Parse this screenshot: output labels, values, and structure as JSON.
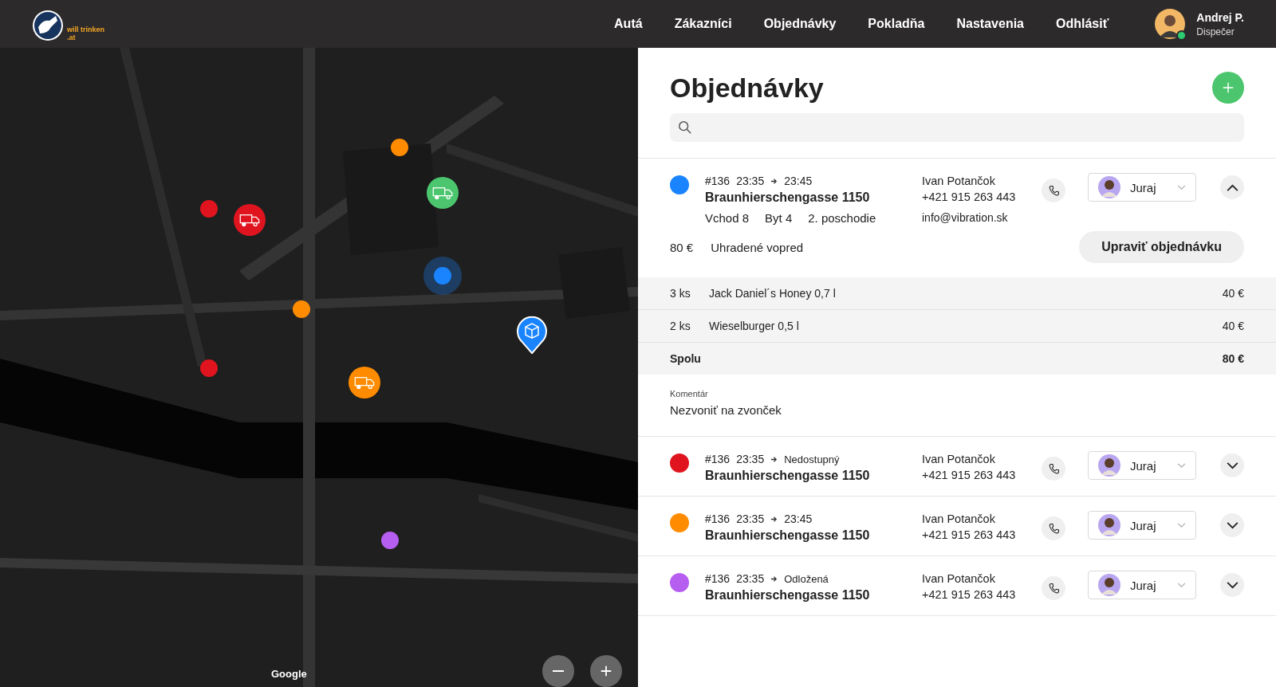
{
  "header": {
    "logo_text": "will trinken .at",
    "nav": [
      {
        "label": "Autá"
      },
      {
        "label": "Zákazníci"
      },
      {
        "label": "Objednávky"
      },
      {
        "label": "Pokladňa"
      },
      {
        "label": "Nastavenia"
      },
      {
        "label": "Odhlásiť"
      }
    ],
    "user": {
      "name": "Andrej P.",
      "role": "Dispečer",
      "online": true
    }
  },
  "map": {
    "attribution": "Google",
    "markers": [
      {
        "kind": "dot",
        "color": "#e0141e"
      },
      {
        "kind": "truck",
        "color": "#e0141e"
      },
      {
        "kind": "dot",
        "color": "#ff8c00"
      },
      {
        "kind": "truck",
        "color": "#4cc66e"
      },
      {
        "kind": "location",
        "color": "#1a84ff"
      },
      {
        "kind": "dot",
        "color": "#ff8c00"
      },
      {
        "kind": "dot",
        "color": "#e0141e"
      },
      {
        "kind": "truck",
        "color": "#ff8c00"
      },
      {
        "kind": "pin",
        "color": "#1a84ff"
      },
      {
        "kind": "dot",
        "color": "#b65ef0"
      }
    ]
  },
  "orders_panel": {
    "title": "Objednávky",
    "orders": [
      {
        "color": "#1a84ff",
        "expanded": true,
        "number": "#136",
        "time_from": "23:35",
        "time_to": "23:45",
        "address": "Braunhierschengasse 1150",
        "customer": "Ivan Potančok",
        "phone": "+421 915 263 443",
        "courier": "Juraj",
        "details": [
          "Vchod 8",
          "Byt 4",
          "2. poschodie"
        ],
        "email": "info@vibration.sk",
        "price": "80 €",
        "payment": "Uhradené vopred",
        "edit_button": "Upraviť objednávku",
        "items": [
          {
            "qty": "3 ks",
            "name": "Jack Daniel´s Honey 0,7 l",
            "price": "40 €"
          },
          {
            "qty": "2 ks",
            "name": "Wieselburger 0,5 l",
            "price": "40 €"
          }
        ],
        "total_label": "Spolu",
        "total": "80 €",
        "comment_label": "Komentár",
        "comment": "Nezvoniť na zvonček"
      },
      {
        "color": "#e0141e",
        "expanded": false,
        "number": "#136",
        "time_from": "23:35",
        "time_to": "Nedostupný",
        "address": "Braunhierschengasse 1150",
        "customer": "Ivan Potančok",
        "phone": "+421 915 263 443",
        "courier": "Juraj"
      },
      {
        "color": "#ff8c00",
        "expanded": false,
        "number": "#136",
        "time_from": "23:35",
        "time_to": "23:45",
        "address": "Braunhierschengasse 1150",
        "customer": "Ivan Potančok",
        "phone": "+421 915 263 443",
        "courier": "Juraj"
      },
      {
        "color": "#b65ef0",
        "expanded": false,
        "number": "#136",
        "time_from": "23:35",
        "time_to": "Odložená",
        "address": "Braunhierschengasse 1150",
        "customer": "Ivan Potančok",
        "phone": "+421 915 263 443",
        "courier": "Juraj"
      }
    ]
  }
}
